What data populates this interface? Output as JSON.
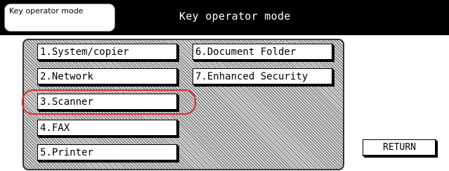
{
  "header": {
    "mode_tab_label": "Key operator mode",
    "title": "Key operator mode"
  },
  "menu": {
    "left": [
      {
        "label": "1.System/copier"
      },
      {
        "label": "2.Network"
      },
      {
        "label": "3.Scanner"
      },
      {
        "label": "4.FAX"
      },
      {
        "label": "5.Printer"
      }
    ],
    "right": [
      {
        "label": "6.Document Folder"
      },
      {
        "label": "7.Enhanced Security"
      }
    ]
  },
  "footer": {
    "return_label": "RETURN"
  },
  "colors": {
    "highlight": "#e0272a",
    "topbar": "#000000"
  }
}
